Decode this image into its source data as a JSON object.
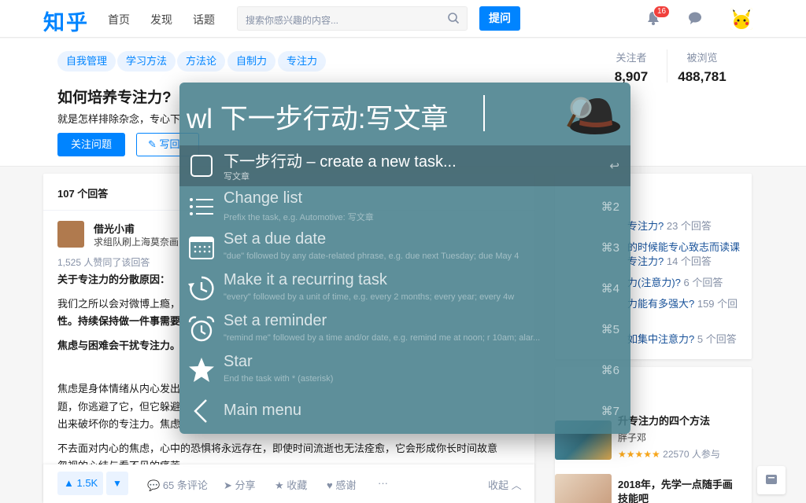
{
  "nav": {
    "logo": "知乎",
    "links": [
      "首页",
      "发现",
      "话题"
    ],
    "search_placeholder": "搜索你感兴趣的内容...",
    "ask_label": "提问",
    "notification_count": "16"
  },
  "question": {
    "tags": [
      "自我管理",
      "学习方法",
      "方法论",
      "自制力",
      "专注力"
    ],
    "title": "如何培养专注力?",
    "description": "就是怎样排除杂念，专心下",
    "follow_label": "关注问题",
    "write_label": "写回",
    "followers_label": "关注者",
    "followers_value": "8,907",
    "views_label": "被浏览",
    "views_value": "488,781"
  },
  "answer": {
    "count_label": "107 个回答",
    "author_name": "借光小甫",
    "author_headline": "求组队刷上海莫奈画",
    "votes_text": "1,525 人赞同了该回答",
    "paragraphs": [
      "关于专注力的分散原因：",
      "我们之所以会对微博上瘾，",
      "性。持续保持做一件事需要",
      "焦虑与困难会干扰专注力。",
      "焦虑是身体情绪从内心发出",
      "题，你逃避了它，但它躲避",
      "出来破坏你的专注力。焦虑",
      "不去面对内心的焦虑，心中的恐惧将永远存在，即使时间流逝也无法痊愈，它会形成你长时间故意",
      "忽视的心结与看不见的痛苦"
    ],
    "upvote_label": "▲ 1.5K",
    "downvote_label": "▼",
    "comments_label": "65 条评论",
    "share_label": "分享",
    "collect_label": "收藏",
    "thanks_label": "感谢",
    "more_label": "···",
    "collapse_label": "收起"
  },
  "sidebar": {
    "related": [
      {
        "title": "专注力?",
        "count": " 23 个回答"
      },
      {
        "title": "的时候能专心致志而读课",
        "count": ""
      },
      {
        "title": "专注力?",
        "count": " 14 个回答"
      },
      {
        "title": "力(注意力)?",
        "count": " 6 个回答"
      },
      {
        "title": "力能有多强大?",
        "count": " 159 个回"
      },
      {
        "title": "如集中注意力?",
        "count": " 5 个回答"
      }
    ],
    "live": [
      {
        "title": "升专注力的四个方法",
        "sub": "胖子邓",
        "rating": "★★★★★",
        "participants": "22570 人参与"
      },
      {
        "title": "2018年，先学一点随手画",
        "sub": "技能吧",
        "rating": "",
        "participants": ""
      }
    ]
  },
  "alfred": {
    "query": "wl 下一步行动:写文章",
    "results": [
      {
        "title": "下一步行动 – create a new task...",
        "subtitle": "写文章",
        "shortcut": "↩",
        "icon": "checkbox-icon"
      },
      {
        "title": "Change list",
        "subtitle": "Prefix the task, e.g. Automotive: 写文章",
        "shortcut": "⌘2",
        "icon": "list-icon"
      },
      {
        "title": "Set a due date",
        "subtitle": "\"due\" followed by any date-related phrase, e.g. due next Tuesday; due May 4",
        "shortcut": "⌘3",
        "icon": "calendar-icon"
      },
      {
        "title": "Make it a recurring task",
        "subtitle": "\"every\" followed by a unit of time, e.g. every 2 months; every year; every 4w",
        "shortcut": "⌘4",
        "icon": "recurring-icon"
      },
      {
        "title": "Set a reminder",
        "subtitle": "\"remind me\" followed by a time and/or date, e.g. remind me at noon; r 10am; alar...",
        "shortcut": "⌘5",
        "icon": "alarm-icon"
      },
      {
        "title": "Star",
        "subtitle": "End the task with * (asterisk)",
        "shortcut": "⌘6",
        "icon": "star-icon"
      },
      {
        "title": "Main menu",
        "subtitle": "",
        "shortcut": "⌘7",
        "icon": "back-icon"
      }
    ]
  }
}
